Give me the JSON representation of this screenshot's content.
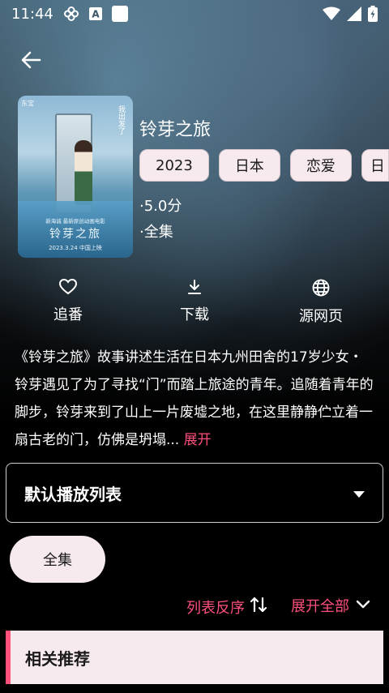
{
  "status_bar": {
    "time": "11:44",
    "icons": [
      "fan-icon",
      "a-box-icon",
      "white-square-icon",
      "wifi-icon",
      "signal-icon",
      "battery-icon"
    ]
  },
  "back_icon": "arrow-left-icon",
  "movie": {
    "title": "铃芽之旅",
    "tags": [
      "2023",
      "日本",
      "恋爱",
      "日"
    ],
    "score": "·5.0分",
    "episodes": "·全集",
    "poster": {
      "title_text": "铃芽之旅",
      "vertical_text": "我出发了",
      "logo_text": "东宝",
      "credit_text": "新海诚 最新原创动画电影",
      "date_text": "2023.3.24 中国上映"
    }
  },
  "actions": [
    {
      "icon": "heart-icon",
      "label": "追番"
    },
    {
      "icon": "download-icon",
      "label": "下载"
    },
    {
      "icon": "globe-icon",
      "label": "源网页"
    }
  ],
  "description": {
    "text": "《铃芽之旅》故事讲述生活在日本九州田舍的17岁少女・铃芽遇见了为了寻找“门”而踏上旅途的青年。追随着青年的脚步，铃芽来到了山上一片废墟之地，在这里静静伫立着一扇古老的门，仿佛是坍塌...",
    "expand_label": "展开"
  },
  "playlist": {
    "selected": "默认播放列表",
    "caret_icon": "caret-down-icon"
  },
  "episode_buttons": [
    "全集"
  ],
  "list_controls": {
    "reverse_label": "列表反序",
    "reverse_icon": "sort-arrows-icon",
    "expand_all_label": "展开全部",
    "expand_all_icon": "chevron-down-icon"
  },
  "recommend": {
    "label": "相关推荐"
  },
  "colors": {
    "accent": "#ff4f7b",
    "chip_bg": "#f7eaee",
    "background": "#000000"
  }
}
